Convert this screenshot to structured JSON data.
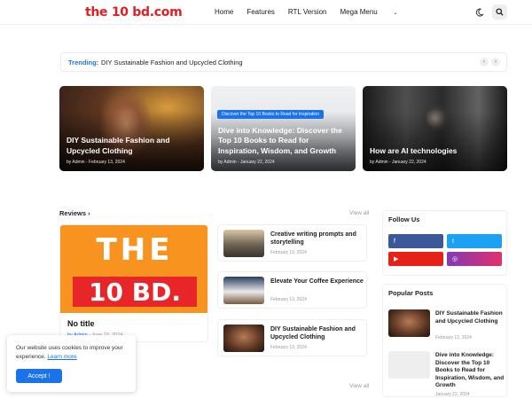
{
  "header": {
    "logo": "the 10 bd.com",
    "nav": [
      {
        "label": "Home"
      },
      {
        "label": "Features"
      },
      {
        "label": "RTL Version"
      },
      {
        "label": "Mega Menu",
        "has_dropdown": true
      }
    ],
    "icons": [
      "moon-icon",
      "search-icon"
    ]
  },
  "trending": {
    "label": "Trending:",
    "text": "DIY Sustainable Fashion and Upcycled Clothing",
    "prev_icon": "chevron-left-icon",
    "next_icon": "chevron-right-icon"
  },
  "hero": [
    {
      "title": "DIY Sustainable Fashion and Upcycled Clothing",
      "meta": "by Admin - February 13, 2024"
    },
    {
      "tag": "Discover the Top 10 Books to Read for Inspiration",
      "title": "Dive into Knowledge: Discover the Top 10 Books to Read for Inspiration, Wisdom, and Growth",
      "meta": "by Admin - January 22, 2024"
    },
    {
      "title": "How are AI technologies",
      "meta": "by Admin - January 22, 2024"
    }
  ],
  "reviews": {
    "heading": "Reviews",
    "view_all": "View all",
    "featured": {
      "logo_top": "THE",
      "logo_bottom": "10 BD.",
      "title": "No title",
      "by": "by Admin",
      "date": "- June 10, 2024"
    },
    "posts": [
      {
        "title": "Creative writing prompts and storytelling",
        "date": "February 13, 2024"
      },
      {
        "title": "Elevate Your Coffee Experience",
        "date": "February 13, 2024"
      },
      {
        "title": "DIY Sustainable Fashion and Upcycled Clothing",
        "date": "February 13, 2024"
      }
    ],
    "view_all_bottom": "View all"
  },
  "follow_us": {
    "heading": "Follow Us",
    "buttons": [
      {
        "icon": "facebook-icon",
        "glyph": "f",
        "color": "#3b5998"
      },
      {
        "icon": "twitter-icon",
        "glyph": "t",
        "color": "#1da1f2"
      },
      {
        "icon": "youtube-icon",
        "glyph": "▶",
        "color": "#e62117"
      },
      {
        "icon": "instagram-icon",
        "glyph": "◎",
        "color": "#c13584"
      }
    ]
  },
  "popular": {
    "heading": "Popular Posts",
    "posts": [
      {
        "title": "DIY Sustainable Fashion and Upcycled Clothing",
        "date": "February 13, 2024"
      },
      {
        "title": "Dive into Knowledge: Discover the Top 10 Books to Read for Inspiration, Wisdom, and Growth",
        "date": "January 22, 2024"
      }
    ]
  },
  "cookie": {
    "text": "Our website uses cookies to improve your experience.",
    "link": "Learn more",
    "button": "Accept !"
  },
  "colors": {
    "brand": "#e02020",
    "accent": "#1a73e8",
    "featured_bg": "#f7931e",
    "logo_block": "#e8262a"
  }
}
